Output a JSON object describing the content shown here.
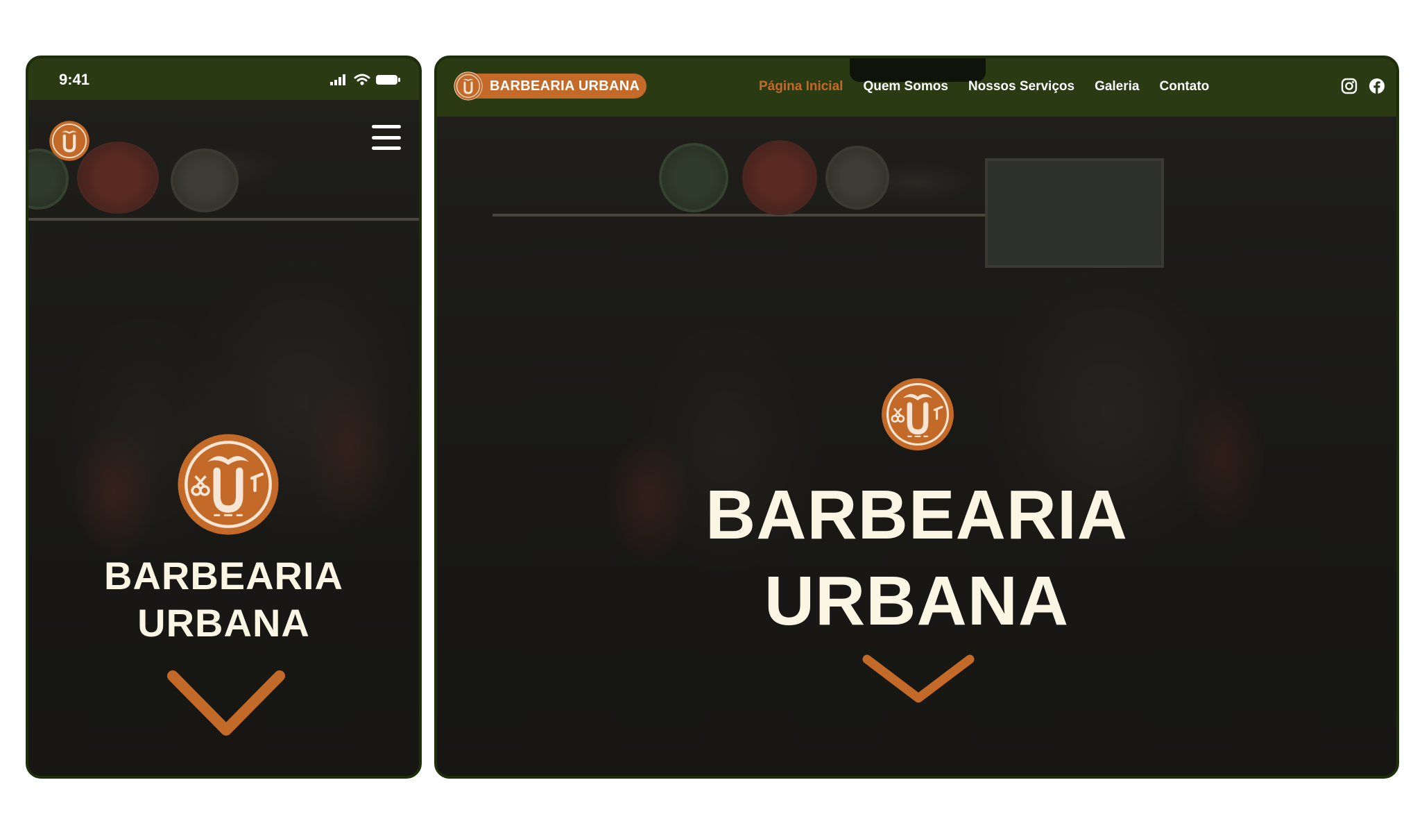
{
  "mobile": {
    "status": {
      "time": "9:41"
    },
    "hero": {
      "line1": "BARBEARIA",
      "line2": "URBANA"
    }
  },
  "desktop": {
    "brand": "BARBEARIA URBANA",
    "nav": [
      {
        "label": "Página Inicial",
        "active": true
      },
      {
        "label": "Quem Somos",
        "active": false
      },
      {
        "label": "Nossos Serviços",
        "active": false
      },
      {
        "label": "Galeria",
        "active": false
      },
      {
        "label": "Contato",
        "active": false
      }
    ],
    "socials": [
      "instagram-icon",
      "facebook-icon"
    ],
    "hero": {
      "line1": "BARBEARIA",
      "line2": "URBANA"
    }
  },
  "colors": {
    "header_green": "#2a3a13",
    "accent_orange": "#c46a28",
    "hero_text": "#fbf6e4",
    "background_dark": "#23221e"
  },
  "icons": [
    "barbershop-logo-icon",
    "mustache-icon",
    "scissors-icon",
    "razor-icon",
    "hamburger-menu-icon",
    "chevron-down-icon",
    "signal-icon",
    "wifi-icon",
    "battery-icon"
  ]
}
